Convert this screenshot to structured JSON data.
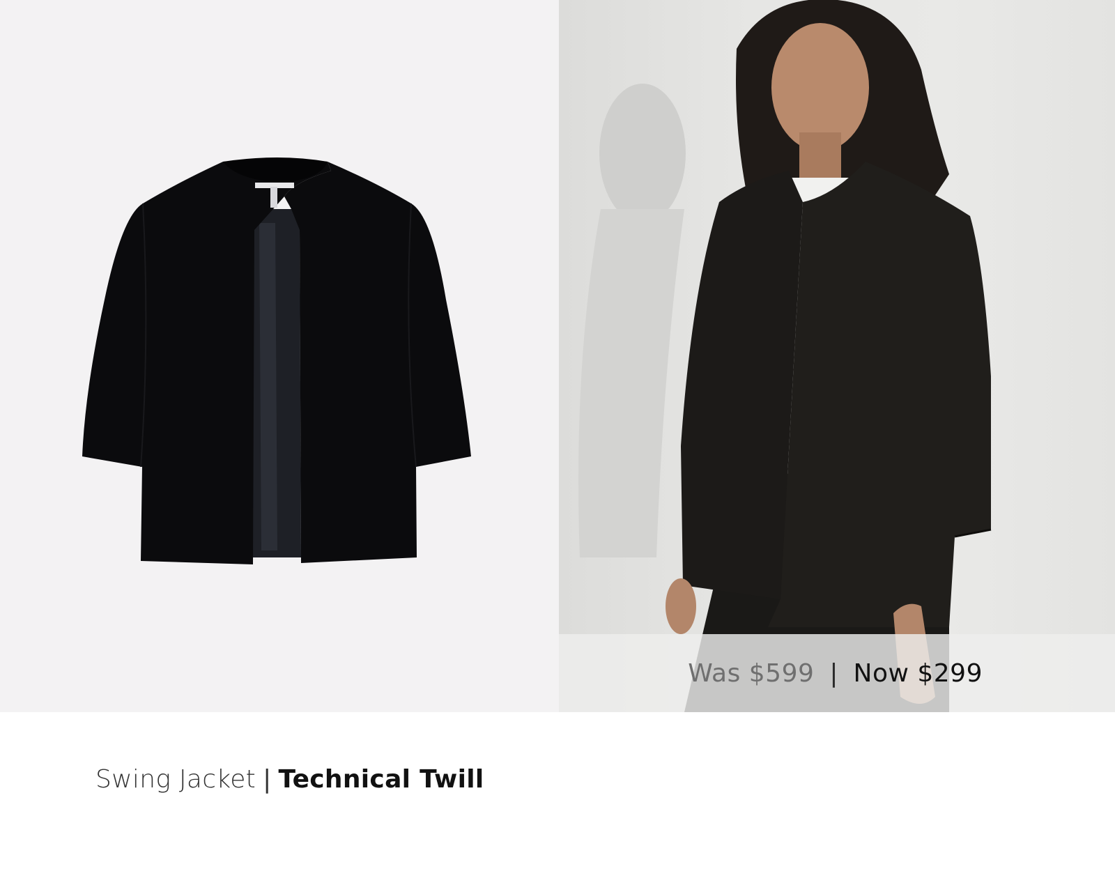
{
  "product": {
    "name": "Swing Jacket",
    "separator": "|",
    "fabric": "Technical Twill"
  },
  "pricing": {
    "was_label": "Was $599",
    "separator": "|",
    "now_label": "Now $299"
  },
  "images": {
    "flatlay": "jacket-flatlay-image",
    "model": "model-wearing-jacket-image"
  },
  "colors": {
    "jacket": "#0b0b0d",
    "flatlay_bg": "#f3f2f3",
    "model_bg": "#e6e6e4",
    "banner_bg": "#eeeeed"
  }
}
